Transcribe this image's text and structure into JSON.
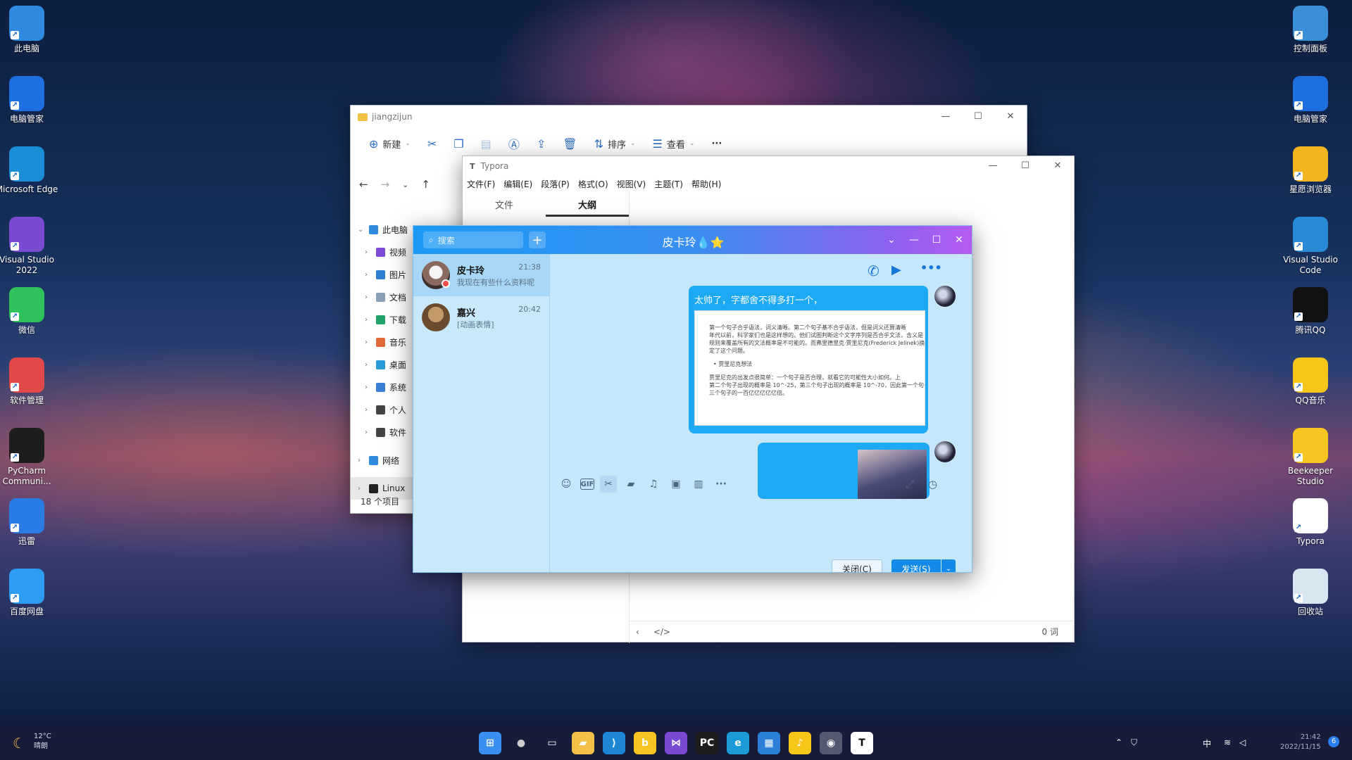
{
  "desktop_left": [
    {
      "label": "此电脑",
      "color": "#2f8be0"
    },
    {
      "label": "电脑管家",
      "color": "#1e6fe0"
    },
    {
      "label": "Microsoft Edge",
      "color": "#1a8fd8"
    },
    {
      "label": "Visual Studio 2022",
      "color": "#7a4ad0"
    },
    {
      "label": "微信",
      "color": "#2fc25b"
    },
    {
      "label": "软件管理",
      "color": "#e0484a"
    },
    {
      "label": "PyCharm Communi...",
      "color": "#1d1d1d"
    },
    {
      "label": "迅雷",
      "color": "#2a7be4"
    },
    {
      "label": "百度网盘",
      "color": "#2e9cf2"
    }
  ],
  "desktop_right": [
    {
      "label": "控制面板",
      "color": "#3b8fd6"
    },
    {
      "label": "电脑管家",
      "color": "#1e6fe0"
    },
    {
      "label": "星愿浏览器",
      "color": "#f2b520"
    },
    {
      "label": "Visual Studio Code",
      "color": "#2a8ad6"
    },
    {
      "label": "腾讯QQ",
      "color": "#111111"
    },
    {
      "label": "QQ音乐",
      "color": "#f5c51a"
    },
    {
      "label": "Beekeeper Studio",
      "color": "#f7c520"
    },
    {
      "label": "Typora",
      "color": "#ffffff"
    },
    {
      "label": "回收站",
      "color": "#d7e7f2"
    }
  ],
  "explorer": {
    "title": "jiangzijun",
    "toolbar": {
      "new": "新建",
      "sort": "排序",
      "view": "查看",
      "more": "···"
    },
    "tree": [
      {
        "label": "此电脑",
        "color": "#2f8be0",
        "indent": 0,
        "chev": "⌄"
      },
      {
        "label": "视频",
        "color": "#7d4bd6",
        "indent": 1,
        "chev": "›"
      },
      {
        "label": "图片",
        "color": "#2f7fd3",
        "indent": 1,
        "chev": "›"
      },
      {
        "label": "文档",
        "color": "#8aa0b6",
        "indent": 1,
        "chev": "›"
      },
      {
        "label": "下载",
        "color": "#23a36a",
        "indent": 1,
        "chev": "›"
      },
      {
        "label": "音乐",
        "color": "#e26a3a",
        "indent": 1,
        "chev": "›"
      },
      {
        "label": "桌面",
        "color": "#2a9ad8",
        "indent": 1,
        "chev": "›"
      },
      {
        "label": "系统",
        "color": "#3a7fd6",
        "indent": 1,
        "chev": "›"
      },
      {
        "label": "个人",
        "color": "#444444",
        "indent": 1,
        "chev": "›"
      },
      {
        "label": "软件",
        "color": "#444444",
        "indent": 1,
        "chev": "›"
      },
      {
        "label": "网络",
        "color": "#2f8be0",
        "indent": 0,
        "chev": "›"
      },
      {
        "label": "Linux",
        "color": "#222222",
        "indent": 0,
        "chev": "›"
      }
    ],
    "status": "18 个项目"
  },
  "typora": {
    "title": "Typora",
    "menu": [
      "文件(F)",
      "编辑(E)",
      "段落(P)",
      "格式(O)",
      "视图(V)",
      "主题(T)",
      "帮助(H)"
    ],
    "tabs": [
      "文件",
      "大纲"
    ],
    "status_words": "0 词"
  },
  "qq": {
    "search_placeholder": "搜索",
    "chat_title": "皮卡玲💧⭐",
    "contacts": [
      {
        "name": "皮卡玲",
        "time": "21:38",
        "msg": "我现在有些什么资料呢"
      },
      {
        "name": "嘉兴",
        "time": "20:42",
        "msg": "[动画表情]"
      }
    ],
    "message_text": "太帅了，字都舍不得多打一个，",
    "doc_lines": [
      "第一个句子合乎语法，词义清晰。第二个句子基不合乎语法，但是词义还算清晰",
      "年代以前，科学家们也是这样想的。他们试图判断这个文字序列是否合乎文法，含义是",
      "规则来覆盖所有的文法概率是不可能的。而弗里德里克·贾里尼克(Frederick Jelinek)换",
      "定了这个问题。",
      "• 贾里尼克想法",
      "贾里尼克的出发点很简单：一个句子是否合理，就看它的可能性大小如何。上",
      "第二个句子出现的概率是 10^-25，第三个句子出现的概率是 10^-70，因此第一个句子",
      "三个句子的一百亿亿亿亿亿倍。"
    ],
    "close_btn": "关闭(C)",
    "send_btn": "发送(S)"
  },
  "weather": {
    "temp": "12°C",
    "desc": "晴朗"
  },
  "clock": {
    "time": "21:42",
    "date": "2022/11/15"
  },
  "notification_count": "6",
  "ime": "中"
}
